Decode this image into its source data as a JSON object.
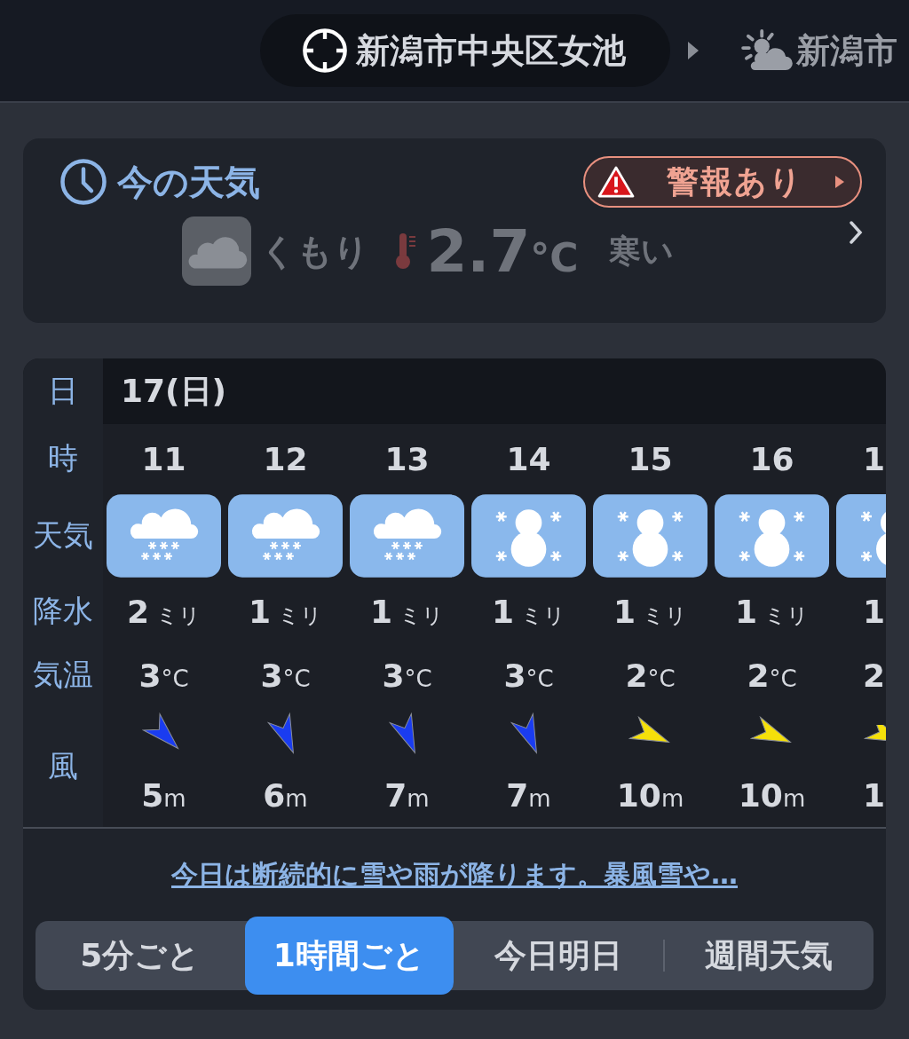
{
  "header": {
    "location": "新潟市中央区女池",
    "next_location": "新潟市"
  },
  "current": {
    "title": "今の天気",
    "alert": "警報あり",
    "condition": "くもり",
    "temperature": "2.7",
    "unit": "°C",
    "feel": "寒い"
  },
  "forecast": {
    "date_label": "日",
    "date": "17(日)",
    "row_labels": {
      "hour": "時",
      "weather": "天気",
      "precip": "降水",
      "temp": "気温",
      "wind": "風"
    },
    "hours": [
      {
        "hour": "11",
        "weather": {
          "kind": "snow"
        },
        "precip": "2",
        "precip_unit": "ミリ",
        "temp": "3",
        "temp_unit": "°C",
        "arrow": {
          "kind": "nw",
          "color": "#1a3cf0"
        },
        "wind": "5",
        "wind_unit": "m"
      },
      {
        "hour": "12",
        "weather": {
          "kind": "snow"
        },
        "precip": "1",
        "precip_unit": "ミリ",
        "temp": "3",
        "temp_unit": "°C",
        "arrow": {
          "kind": "nnw",
          "color": "#1a3cf0"
        },
        "wind": "6",
        "wind_unit": "m"
      },
      {
        "hour": "13",
        "weather": {
          "kind": "snow"
        },
        "precip": "1",
        "precip_unit": "ミリ",
        "temp": "3",
        "temp_unit": "°C",
        "arrow": {
          "kind": "nnw",
          "color": "#1a3cf0"
        },
        "wind": "7",
        "wind_unit": "m"
      },
      {
        "hour": "14",
        "weather": {
          "kind": "snowman"
        },
        "precip": "1",
        "precip_unit": "ミリ",
        "temp": "3",
        "temp_unit": "°C",
        "arrow": {
          "kind": "nnw",
          "color": "#1a3cf0"
        },
        "wind": "7",
        "wind_unit": "m"
      },
      {
        "hour": "15",
        "weather": {
          "kind": "snowman"
        },
        "precip": "1",
        "precip_unit": "ミリ",
        "temp": "2",
        "temp_unit": "°C",
        "arrow": {
          "kind": "wnw",
          "color": "#f5e00a"
        },
        "wind": "10",
        "wind_unit": "m"
      },
      {
        "hour": "16",
        "weather": {
          "kind": "snowman"
        },
        "precip": "1",
        "precip_unit": "ミリ",
        "temp": "2",
        "temp_unit": "°C",
        "arrow": {
          "kind": "wnw",
          "color": "#f5e00a"
        },
        "wind": "10",
        "wind_unit": "m"
      },
      {
        "hour": "1",
        "weather": {
          "kind": "snowman"
        },
        "precip": "1",
        "temp": "2",
        "arrow": {
          "kind": "wnw",
          "color": "#f5e00a"
        },
        "wind": "1"
      }
    ],
    "summary_link": "今日は断続的に雪や雨が降ります。暴風雪や…"
  },
  "tabs": [
    {
      "label": "5分ごと",
      "selected": false
    },
    {
      "label": "1時間ごと",
      "selected": true
    },
    {
      "label": "今日明日",
      "selected": false
    },
    {
      "label": "週間天気",
      "selected": false
    }
  ]
}
